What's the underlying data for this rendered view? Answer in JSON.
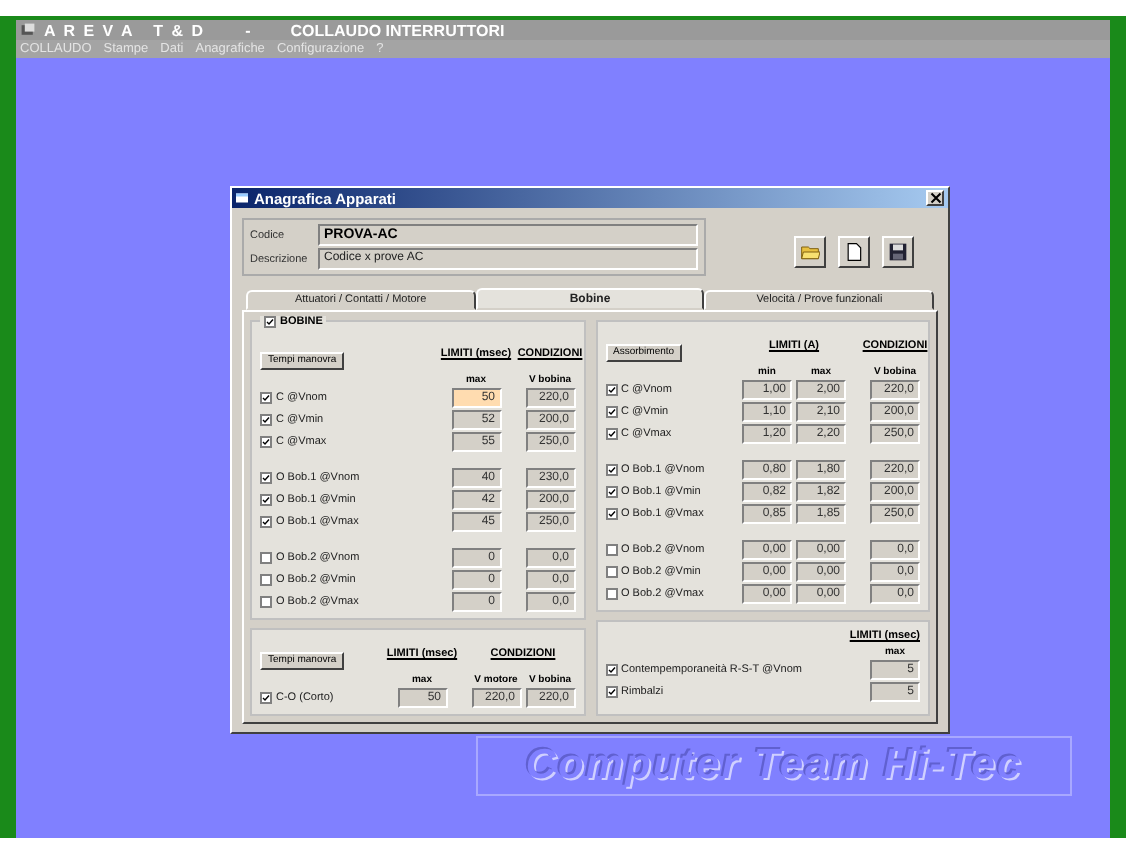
{
  "app": {
    "title_brand": "A R E V A   T & D",
    "title_separator": "-",
    "title_name": "COLLAUDO INTERRUTTORI"
  },
  "menu": [
    "COLLAUDO",
    "Stampe",
    "Dati",
    "Anagrafiche",
    "Configurazione",
    "?"
  ],
  "dialog": {
    "title": "Anagrafica Apparati",
    "fields": [
      {
        "label": "Codice",
        "value": "PROVA-AC",
        "bold": true
      },
      {
        "label": "Descrizione",
        "value": "Codice x prove AC",
        "bold": false
      }
    ],
    "tabs": [
      {
        "label": "Attuatori / Contatti / Motore",
        "selected": false
      },
      {
        "label": "Bobine",
        "selected": true
      },
      {
        "label": "Velocità / Prove funzionali",
        "selected": false
      }
    ],
    "left_panel": {
      "title": "BOBINE",
      "checked": true,
      "button": "Tempi manovra",
      "limits_header": "LIMITI (msec)",
      "limits_sub": [
        "max"
      ],
      "conditions_header": "CONDIZIONI",
      "conditions_sub": [
        "V bobina"
      ],
      "groups": [
        [
          {
            "label": "C @Vnom",
            "checked": true,
            "values": [
              "50"
            ],
            "conditions": [
              "220,0"
            ],
            "focused": true
          },
          {
            "label": "C @Vmin",
            "checked": true,
            "values": [
              "52"
            ],
            "conditions": [
              "200,0"
            ],
            "focused": false
          },
          {
            "label": "C @Vmax",
            "checked": true,
            "values": [
              "55"
            ],
            "conditions": [
              "250,0"
            ],
            "focused": false
          }
        ],
        [
          {
            "label": "O Bob.1 @Vnom",
            "checked": true,
            "values": [
              "40"
            ],
            "conditions": [
              "230,0"
            ],
            "focused": false
          },
          {
            "label": "O Bob.1 @Vmin",
            "checked": true,
            "values": [
              "42"
            ],
            "conditions": [
              "200,0"
            ],
            "focused": false
          },
          {
            "label": "O Bob.1 @Vmax",
            "checked": true,
            "values": [
              "45"
            ],
            "conditions": [
              "250,0"
            ],
            "focused": false
          }
        ],
        [
          {
            "label": "O Bob.2 @Vnom",
            "checked": false,
            "values": [
              "0"
            ],
            "conditions": [
              "0,0"
            ],
            "focused": false
          },
          {
            "label": "O Bob.2 @Vmin",
            "checked": false,
            "values": [
              "0"
            ],
            "conditions": [
              "0,0"
            ],
            "focused": false
          },
          {
            "label": "O Bob.2 @Vmax",
            "checked": false,
            "values": [
              "0"
            ],
            "conditions": [
              "0,0"
            ],
            "focused": false
          }
        ]
      ]
    },
    "right_panel": {
      "button": "Assorbimento",
      "limits_header": "LIMITI (A)",
      "limits_sub": [
        "min",
        "max"
      ],
      "conditions_header": "CONDIZIONI",
      "conditions_sub": [
        "V bobina"
      ],
      "groups": [
        [
          {
            "label": "C @Vnom",
            "checked": true,
            "values": [
              "1,00",
              "2,00"
            ],
            "conditions": [
              "220,0"
            ],
            "focused": false
          },
          {
            "label": "C @Vmin",
            "checked": true,
            "values": [
              "1,10",
              "2,10"
            ],
            "conditions": [
              "200,0"
            ],
            "focused": false
          },
          {
            "label": "C @Vmax",
            "checked": true,
            "values": [
              "1,20",
              "2,20"
            ],
            "conditions": [
              "250,0"
            ],
            "focused": false
          }
        ],
        [
          {
            "label": "O Bob.1 @Vnom",
            "checked": true,
            "values": [
              "0,80",
              "1,80"
            ],
            "conditions": [
              "220,0"
            ],
            "focused": false
          },
          {
            "label": "O Bob.1 @Vmin",
            "checked": true,
            "values": [
              "0,82",
              "1,82"
            ],
            "conditions": [
              "200,0"
            ],
            "focused": false
          },
          {
            "label": "O Bob.1 @Vmax",
            "checked": true,
            "values": [
              "0,85",
              "1,85"
            ],
            "conditions": [
              "250,0"
            ],
            "focused": false
          }
        ],
        [
          {
            "label": "O Bob.2 @Vnom",
            "checked": false,
            "values": [
              "0,00",
              "0,00"
            ],
            "conditions": [
              "0,0"
            ],
            "focused": false
          },
          {
            "label": "O Bob.2 @Vmin",
            "checked": false,
            "values": [
              "0,00",
              "0,00"
            ],
            "conditions": [
              "0,0"
            ],
            "focused": false
          },
          {
            "label": "O Bob.2 @Vmax",
            "checked": false,
            "values": [
              "0,00",
              "0,00"
            ],
            "conditions": [
              "0,0"
            ],
            "focused": false
          }
        ]
      ]
    },
    "bottom_left": {
      "button": "Tempi manovra",
      "limits_header": "LIMITI (msec)",
      "limits_sub": [
        "max"
      ],
      "conditions_header": "CONDIZIONI",
      "conditions_sub": [
        "V motore",
        "V bobina"
      ],
      "groups": [
        [
          {
            "label": "C-O (Corto)",
            "checked": true,
            "values": [
              "50"
            ],
            "conditions": [
              "220,0",
              "220,0"
            ],
            "focused": false
          }
        ]
      ]
    },
    "bottom_right": {
      "limits_header": "LIMITI (msec)",
      "limits_sub": [
        "max"
      ],
      "groups": [
        [
          {
            "label": "Contempemporaneità R-S-T @Vnom",
            "checked": true,
            "values": [
              "5"
            ],
            "focused": false
          },
          {
            "label": "Rimbalzi",
            "checked": true,
            "values": [
              "5"
            ],
            "focused": false
          }
        ]
      ]
    }
  },
  "watermark": "Computer Team Hi-Tec"
}
